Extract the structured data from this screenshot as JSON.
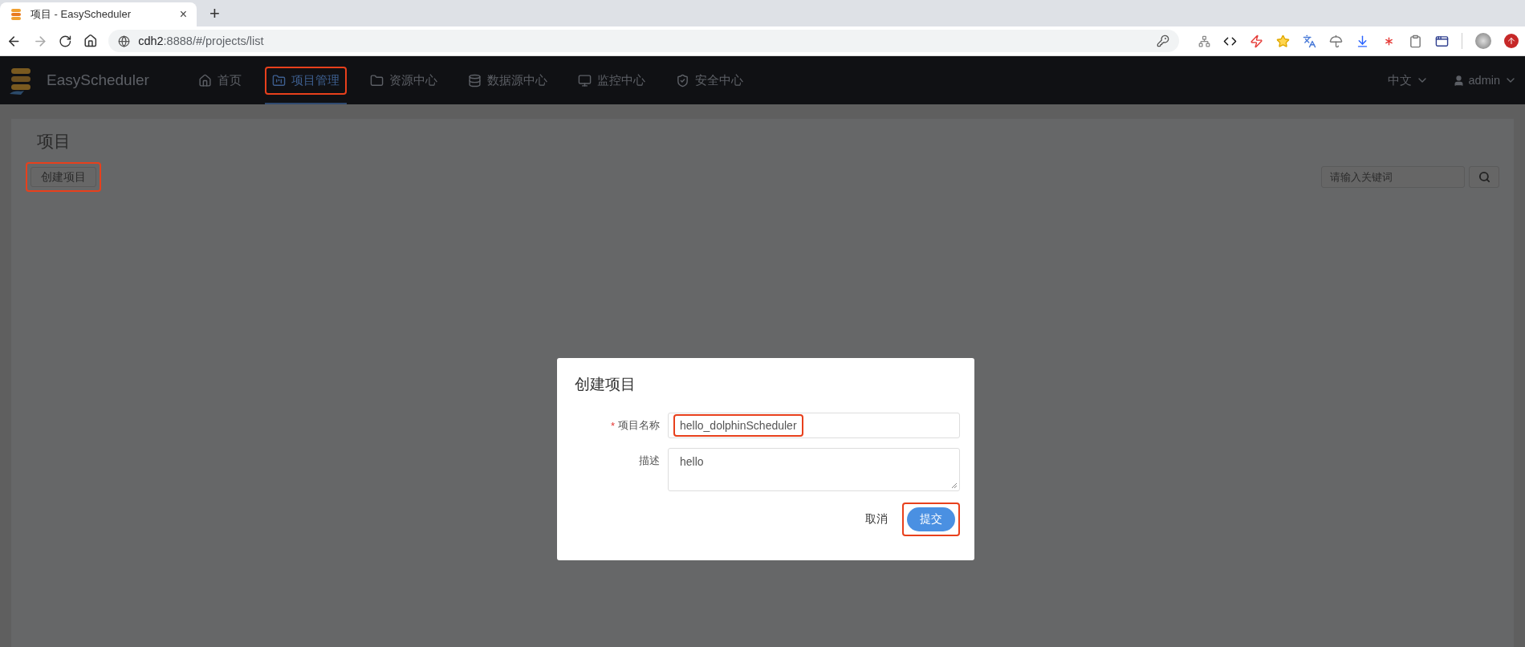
{
  "browser": {
    "tab": {
      "title": "项目 - EasyScheduler",
      "close": "×"
    },
    "new_tab": "+",
    "address": {
      "host": "cdh2",
      "rest": ":8888/#/projects/list"
    }
  },
  "app": {
    "brand": "EasyScheduler",
    "nav": [
      {
        "label": "首页",
        "selected": false,
        "highlighted": false
      },
      {
        "label": "项目管理",
        "selected": true,
        "highlighted": true
      },
      {
        "label": "资源中心",
        "selected": false,
        "highlighted": false
      },
      {
        "label": "数据源中心",
        "selected": false,
        "highlighted": false
      },
      {
        "label": "监控中心",
        "selected": false,
        "highlighted": false
      },
      {
        "label": "安全中心",
        "selected": false,
        "highlighted": false
      }
    ],
    "language": "中文",
    "user": "admin"
  },
  "page": {
    "title": "项目",
    "create_button": {
      "label": "创建项目",
      "highlighted": true
    },
    "search": {
      "placeholder": "请输入关键词"
    }
  },
  "dialog": {
    "title": "创建项目",
    "fields": [
      {
        "label": "项目名称",
        "marker": "*",
        "kind": "input",
        "value": "hello_dolphinScheduler",
        "highlighted": true
      },
      {
        "label": "描述",
        "kind": "textarea",
        "value": "hello",
        "highlighted": false
      }
    ],
    "cancel": "取消",
    "submit": {
      "label": "提交",
      "highlighted": true
    }
  }
}
